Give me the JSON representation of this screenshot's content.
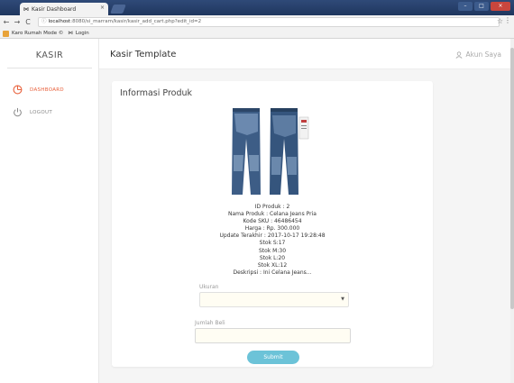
{
  "browser": {
    "tab_title": "Kasir Dashboard",
    "tab_close": "×",
    "url_host": "localhost",
    "url_rest": ":8080/si_marram/kasir/kasir_add_cart.php?edit_id=2",
    "bookmarks": [
      {
        "label": "Karo Rumah Mode ©"
      },
      {
        "label": "Login"
      }
    ],
    "window_controls": [
      "–",
      "□",
      "×"
    ]
  },
  "sidebar": {
    "brand": "KASIR",
    "items": [
      {
        "label": "DASHBOARD",
        "active": true
      },
      {
        "label": "LOGOUT",
        "active": false
      }
    ]
  },
  "header": {
    "title": "Kasir Template",
    "account": "Akun Saya"
  },
  "card": {
    "title": "Informasi Produk",
    "info_lines": [
      "ID Produk : 2",
      "Nama Produk : Celana Jeans Pria",
      "Kode SKU : 46486454",
      "Harga : Rp. 300.000",
      "Update Terakhir : 2017-10-17 19:28:48",
      "Stok S:17",
      "Stok M:30",
      "Stok L:20",
      "Stok XL:12",
      "Deskripsi : Ini Celana Jeans..."
    ],
    "size_label": "Ukuran",
    "size_value": "",
    "qty_label": "Jumlah Beli",
    "qty_value": "",
    "submit_label": "Submit"
  },
  "colors": {
    "accent": "#e8613c",
    "button": "#6cc3d8",
    "tabbar": "#2f4a78"
  }
}
